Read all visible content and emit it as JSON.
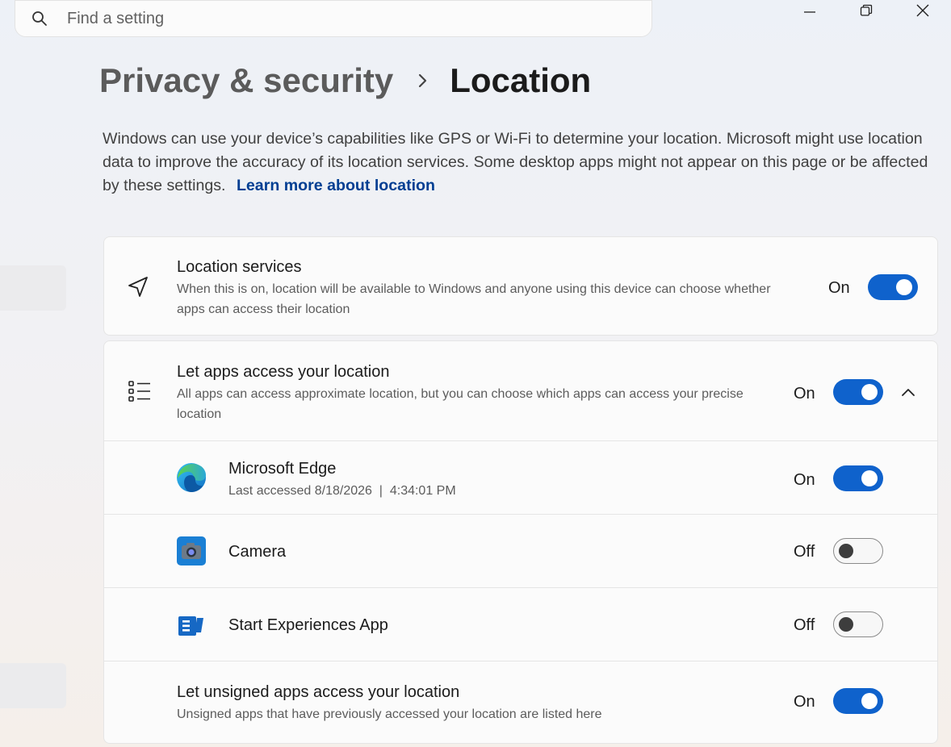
{
  "search": {
    "placeholder": "Find a setting"
  },
  "breadcrumb": {
    "parent": "Privacy & security",
    "current": "Location"
  },
  "description": {
    "text": "Windows can use your device’s capabilities like GPS or Wi-Fi to determine your location. Microsoft might use location data to improve the accuracy of its location services. Some desktop apps might not appear on this page or be affected by these settings.",
    "link": "Learn more about location"
  },
  "location_services": {
    "title": "Location services",
    "subtitle": "When this is on, location will be available to Windows and anyone using this device can choose whether apps can access their location",
    "state": "On",
    "enabled": true
  },
  "apps_access": {
    "title": "Let apps access your location",
    "subtitle": "All apps can access approximate location, but you can choose which apps can access your precise location",
    "state": "On",
    "enabled": true,
    "expanded": true
  },
  "apps": [
    {
      "name": "Microsoft Edge",
      "detail": "Last accessed 8/18/2026  |  4:34:01 PM",
      "state": "On",
      "enabled": true,
      "icon": "edge-icon"
    },
    {
      "name": "Camera",
      "detail": "",
      "state": "Off",
      "enabled": false,
      "icon": "camera-icon"
    },
    {
      "name": "Start Experiences App",
      "detail": "",
      "state": "Off",
      "enabled": false,
      "icon": "start-experiences-icon"
    }
  ],
  "unsigned_apps": {
    "title": "Let unsigned apps access your location",
    "subtitle": "Unsigned apps that have previously accessed your location are listed here",
    "state": "On",
    "enabled": true
  },
  "colors": {
    "accent": "#0f62cc",
    "link": "#003e92"
  }
}
